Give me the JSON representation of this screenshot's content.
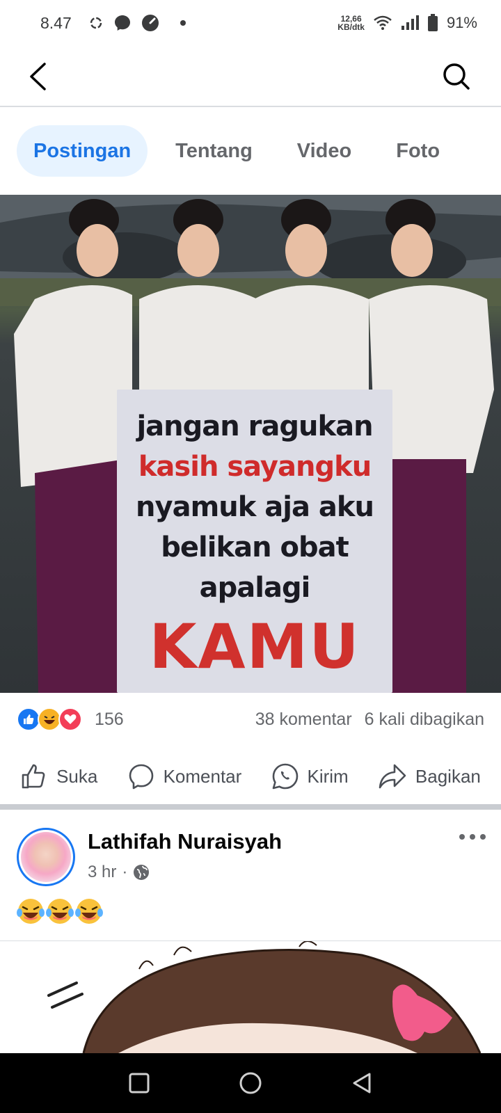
{
  "status_bar": {
    "time": "8.47",
    "net_speed_value": "12,66",
    "net_speed_unit": "KB/dtk",
    "battery": "91%"
  },
  "top_nav": {
    "back_icon": "chevron-left-icon",
    "search_icon": "search-icon"
  },
  "tabs": [
    {
      "label": "Postingan",
      "active": true
    },
    {
      "label": "Tentang",
      "active": false
    },
    {
      "label": "Video",
      "active": false
    },
    {
      "label": "Foto",
      "active": false
    }
  ],
  "post1": {
    "banner_lines": [
      "jangan ragukan",
      "kasih sayangku",
      "nyamuk aja aku",
      "belikan obat",
      "apalagi"
    ],
    "banner_big": "KAMU",
    "reactions": [
      "like-reaction-icon",
      "haha-reaction-icon",
      "love-reaction-icon"
    ],
    "reaction_count": "156",
    "comment_count": "38 komentar",
    "share_count": "6 kali dibagikan",
    "actions": {
      "like": "Suka",
      "comment": "Komentar",
      "send": "Kirim",
      "share": "Bagikan"
    }
  },
  "post2": {
    "author": "Lathifah Nuraisyah",
    "time": "3 hr",
    "separator": "·",
    "privacy_icon": "globe-icon",
    "text_emojis": [
      "laughing-tears-emoji",
      "laughing-tears-emoji",
      "laughing-tears-emoji"
    ]
  },
  "colors": {
    "accent": "#1b74e4",
    "tab_active_bg": "#e7f3ff",
    "banner_red": "#d0312d",
    "muted_text": "#65676b"
  }
}
